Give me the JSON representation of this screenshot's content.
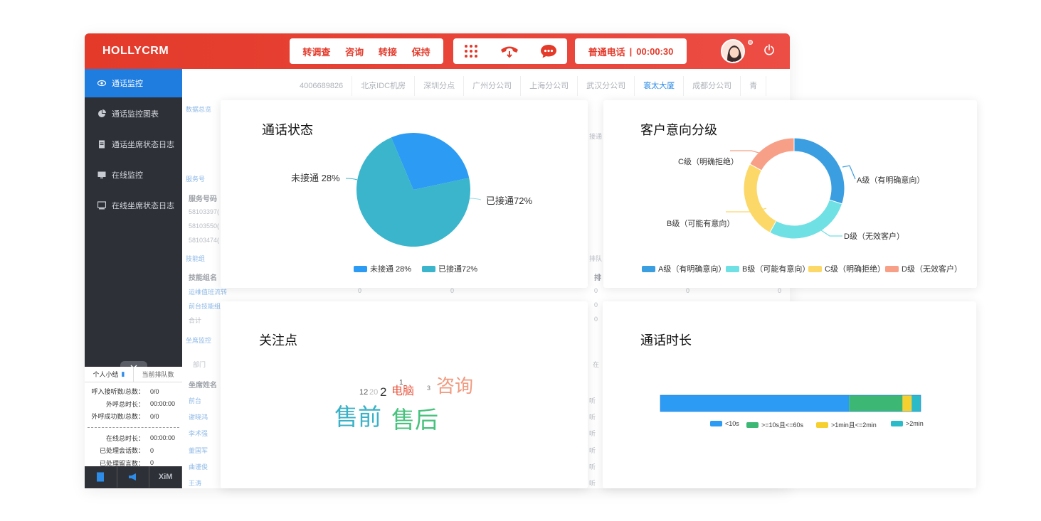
{
  "app": {
    "logo": "HOLLYCRM",
    "actions": [
      "转调查",
      "咨询",
      "转接",
      "保持"
    ],
    "call_status": {
      "type": "普通电话",
      "separator": "|",
      "timer": "00:00:30"
    }
  },
  "sidebar": {
    "items": [
      {
        "label": "通话监控",
        "icon": "eye-icon",
        "active": true
      },
      {
        "label": "通话监控图表",
        "icon": "pie-chart-icon",
        "active": false
      },
      {
        "label": "通话坐席状态日志",
        "icon": "document-icon",
        "active": false
      },
      {
        "label": "在线监控",
        "icon": "monitor-icon",
        "active": false
      },
      {
        "label": "在线坐席状态日志",
        "icon": "monitor-log-icon",
        "active": false
      }
    ],
    "summary": {
      "tab_personal": "个人小结",
      "tab_queue": "当前排队数",
      "rows_top": [
        {
          "k": "呼入接听数/总数：",
          "v": "0/0"
        },
        {
          "k": "外呼总时长：",
          "v": "00:00:00"
        },
        {
          "k": "外呼成功数/总数：",
          "v": "0/0"
        }
      ],
      "rows_bottom": [
        {
          "k": "在线总时长：",
          "v": "00:00:00"
        },
        {
          "k": "已处理会话数：",
          "v": "0"
        },
        {
          "k": "已处理留言数：",
          "v": "0"
        }
      ],
      "bottom_buttons": [
        "",
        "",
        "XiM"
      ]
    }
  },
  "branches": [
    "4006689826",
    "北京IDC机房",
    "深圳分点",
    "广州分公司",
    "上海分公司",
    "武汉分公司",
    "寰太大厦",
    "成都分公司",
    "青"
  ],
  "background": {
    "sec_data": "数据总览",
    "sec_service": "服务号",
    "col_service": "服务号码",
    "service_rows": [
      "58103397(",
      "58103550(",
      "58103474("
    ],
    "sec_skill": "技能组",
    "col_skill": "技能组名",
    "skill_rows": [
      "运维值班流转",
      "前台技能组",
      "合计"
    ],
    "sec_agent": "坐席监控",
    "dept": "部门",
    "col_agent": "坐席姓名",
    "agent_rows": [
      "前台",
      "谢晓鸿",
      "李术强",
      "董国军",
      "曲谨俊",
      "王涛"
    ],
    "zero": "0",
    "right_fragments": [
      "接通",
      "排队",
      "排",
      "在",
      "听"
    ]
  },
  "cards": {
    "call_status": {
      "title": "通话状态"
    },
    "intent": {
      "title": "客户意向分级"
    },
    "focus": {
      "title": "关注点",
      "words": [
        {
          "text": "12",
          "color": "#555555"
        },
        {
          "text": "20",
          "color": "#bbbbbb"
        },
        {
          "text": "2",
          "color": "#333333"
        },
        {
          "text": "电脑",
          "color": "#e8563f"
        },
        {
          "text": "1",
          "color": "#555555"
        },
        {
          "text": "3",
          "color": "#777777"
        },
        {
          "text": "咨询",
          "color": "#f09a7f"
        },
        {
          "text": "售前",
          "color": "#3bb1c7"
        },
        {
          "text": "售后",
          "color": "#47c27d"
        }
      ]
    },
    "duration": {
      "title": "通话时长"
    }
  },
  "chart_data": [
    {
      "type": "pie",
      "title": "通话状态",
      "slices": [
        {
          "label": "未接通 28%",
          "value": 28,
          "color": "#2b9bf4"
        },
        {
          "label": "已接通72%",
          "value": 72,
          "color": "#3bb5cc"
        }
      ],
      "legend": [
        "未接通 28%",
        "已接通72%"
      ],
      "legend_position": "bottom"
    },
    {
      "type": "pie",
      "variant": "donut",
      "title": "客户意向分级",
      "slices": [
        {
          "label": "A级（有明确意向）",
          "value": 30,
          "color": "#3b9ee0"
        },
        {
          "label": "D级（无效客户）",
          "value": 28,
          "color": "#6fe0e4"
        },
        {
          "label": "B级（可能有意向）",
          "value": 25,
          "color": "#fbd867"
        },
        {
          "label": "C级（明确拒绝）",
          "value": 17,
          "color": "#f7a087"
        }
      ],
      "legend": [
        {
          "label": "A级（有明确意向）",
          "color": "#3b9ee0"
        },
        {
          "label": "B级（可能有意向）",
          "color": "#6fe0e4"
        },
        {
          "label": "C级（明确拒绝）",
          "color": "#fbd867"
        },
        {
          "label": "D级（无效客户）",
          "color": "#f7a087"
        }
      ],
      "legend_position": "bottom"
    },
    {
      "type": "bar",
      "variant": "stacked-horizontal",
      "title": "通话时长",
      "series": [
        {
          "name": "<10s",
          "value": 72.5,
          "color": "#2b9bf4"
        },
        {
          "name": ">=10s且<=60s",
          "value": 20.5,
          "color": "#3cb874"
        },
        {
          "name": ">1min且<=2min",
          "value": 3.5,
          "color": "#f6d02f"
        },
        {
          "name": ">2min",
          "value": 3.5,
          "color": "#2bbac8"
        }
      ],
      "legend_position": "bottom-right"
    }
  ]
}
